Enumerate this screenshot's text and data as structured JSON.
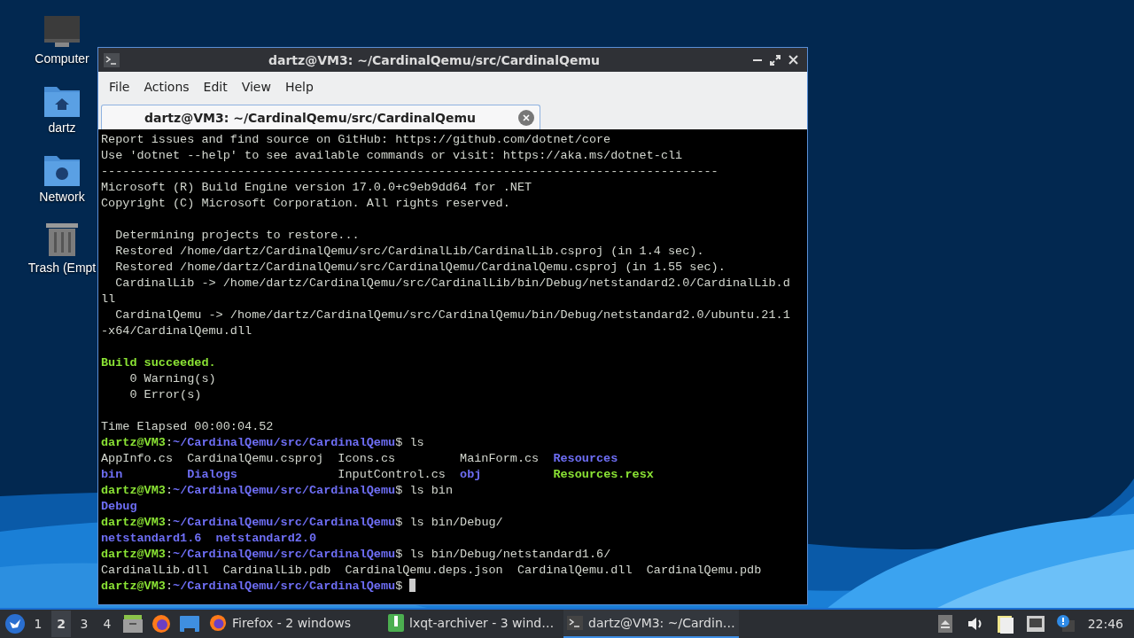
{
  "desktop_icons": [
    {
      "kind": "computer",
      "label": "Computer"
    },
    {
      "kind": "home",
      "label": "dartz"
    },
    {
      "kind": "network",
      "label": "Network"
    },
    {
      "kind": "trash",
      "label": "Trash (Empt"
    }
  ],
  "window": {
    "title": "dartz@VM3: ~/CardinalQemu/src/CardinalQemu",
    "menu": [
      "File",
      "Actions",
      "Edit",
      "View",
      "Help"
    ],
    "tabs": [
      {
        "label": "dartz@VM3: ~/CardinalQemu/src/CardinalQemu",
        "selected": true
      }
    ],
    "terminal": [
      {
        "segments": [
          {
            "kind": "plain",
            "text": "Report issues and find source on GitHub: https://github.com/dotnet/core"
          }
        ]
      },
      {
        "segments": [
          {
            "kind": "plain",
            "text": "Use 'dotnet --help' to see available commands or visit: https://aka.ms/dotnet-cli"
          }
        ]
      },
      {
        "segments": [
          {
            "kind": "plain",
            "text": "--------------------------------------------------------------------------------------"
          }
        ]
      },
      {
        "segments": [
          {
            "kind": "plain",
            "text": "Microsoft (R) Build Engine version 17.0.0+c9eb9dd64 for .NET"
          }
        ]
      },
      {
        "segments": [
          {
            "kind": "plain",
            "text": "Copyright (C) Microsoft Corporation. All rights reserved."
          }
        ]
      },
      {
        "kind": "blank"
      },
      {
        "segments": [
          {
            "kind": "plain",
            "text": "  Determining projects to restore..."
          }
        ]
      },
      {
        "segments": [
          {
            "kind": "plain",
            "text": "  Restored /home/dartz/CardinalQemu/src/CardinalLib/CardinalLib.csproj (in 1.4 sec)."
          }
        ]
      },
      {
        "segments": [
          {
            "kind": "plain",
            "text": "  Restored /home/dartz/CardinalQemu/src/CardinalQemu/CardinalQemu.csproj (in 1.55 sec)."
          }
        ]
      },
      {
        "segments": [
          {
            "kind": "plain",
            "text": "  CardinalLib -> /home/dartz/CardinalQemu/src/CardinalLib/bin/Debug/netstandard2.0/CardinalLib.d"
          }
        ]
      },
      {
        "segments": [
          {
            "kind": "plain",
            "text": "ll"
          }
        ]
      },
      {
        "segments": [
          {
            "kind": "plain",
            "text": "  CardinalQemu -> /home/dartz/CardinalQemu/src/CardinalQemu/bin/Debug/netstandard2.0/ubuntu.21.1"
          }
        ]
      },
      {
        "segments": [
          {
            "kind": "plain",
            "text": "-x64/CardinalQemu.dll"
          }
        ]
      },
      {
        "kind": "blank"
      },
      {
        "segments": [
          {
            "kind": "success",
            "text": "Build succeeded."
          }
        ]
      },
      {
        "segments": [
          {
            "kind": "plain",
            "text": "    0 Warning(s)"
          }
        ]
      },
      {
        "segments": [
          {
            "kind": "plain",
            "text": "    0 Error(s)"
          }
        ]
      },
      {
        "kind": "blank"
      },
      {
        "segments": [
          {
            "kind": "plain",
            "text": "Time Elapsed 00:00:04.52"
          }
        ]
      },
      {
        "segments": [
          {
            "kind": "user",
            "text": "dartz@VM3"
          },
          {
            "kind": "plain",
            "text": ":"
          },
          {
            "kind": "path",
            "text": "~/CardinalQemu/src/CardinalQemu"
          },
          {
            "kind": "plain",
            "text": "$ ls"
          }
        ]
      },
      {
        "segments": [
          {
            "kind": "plain",
            "text": "AppInfo.cs  CardinalQemu.csproj  Icons.cs         MainForm.cs  "
          },
          {
            "kind": "dir",
            "text": "Resources"
          }
        ]
      },
      {
        "segments": [
          {
            "kind": "dir",
            "text": "bin         "
          },
          {
            "kind": "dir",
            "text": "Dialogs"
          },
          {
            "kind": "plain",
            "text": "              InputControl.cs  "
          },
          {
            "kind": "dir",
            "text": "obj          "
          },
          {
            "kind": "success",
            "text": "Resources.resx"
          }
        ]
      },
      {
        "segments": [
          {
            "kind": "user",
            "text": "dartz@VM3"
          },
          {
            "kind": "plain",
            "text": ":"
          },
          {
            "kind": "path",
            "text": "~/CardinalQemu/src/CardinalQemu"
          },
          {
            "kind": "plain",
            "text": "$ ls bin"
          }
        ]
      },
      {
        "segments": [
          {
            "kind": "dir",
            "text": "Debug"
          }
        ]
      },
      {
        "segments": [
          {
            "kind": "user",
            "text": "dartz@VM3"
          },
          {
            "kind": "plain",
            "text": ":"
          },
          {
            "kind": "path",
            "text": "~/CardinalQemu/src/CardinalQemu"
          },
          {
            "kind": "plain",
            "text": "$ ls bin/Debug/"
          }
        ]
      },
      {
        "segments": [
          {
            "kind": "dir",
            "text": "netstandard1.6  netstandard2.0"
          }
        ]
      },
      {
        "segments": [
          {
            "kind": "user",
            "text": "dartz@VM3"
          },
          {
            "kind": "plain",
            "text": ":"
          },
          {
            "kind": "path",
            "text": "~/CardinalQemu/src/CardinalQemu"
          },
          {
            "kind": "plain",
            "text": "$ ls bin/Debug/netstandard1.6/"
          }
        ]
      },
      {
        "segments": [
          {
            "kind": "plain",
            "text": "CardinalLib.dll  CardinalLib.pdb  CardinalQemu.deps.json  CardinalQemu.dll  CardinalQemu.pdb"
          }
        ]
      },
      {
        "cursor": true,
        "segments": [
          {
            "kind": "user",
            "text": "dartz@VM3"
          },
          {
            "kind": "plain",
            "text": ":"
          },
          {
            "kind": "path",
            "text": "~/CardinalQemu/src/CardinalQemu"
          },
          {
            "kind": "plain",
            "text": "$ "
          }
        ]
      }
    ]
  },
  "taskbar": {
    "workspaces": [
      {
        "label": "1",
        "selected": false
      },
      {
        "label": "2",
        "selected": true
      },
      {
        "label": "3",
        "selected": false
      },
      {
        "label": "4",
        "selected": false
      }
    ],
    "tasks": [
      {
        "kind": "firefox",
        "label": "Firefox - 2 windows",
        "selected": false
      },
      {
        "kind": "archiver",
        "label": "lxqt-archiver - 3 wind…",
        "selected": false
      },
      {
        "kind": "terminal",
        "label": "dartz@VM3: ~/Cardin…",
        "selected": true
      }
    ],
    "clock": "22:46"
  }
}
